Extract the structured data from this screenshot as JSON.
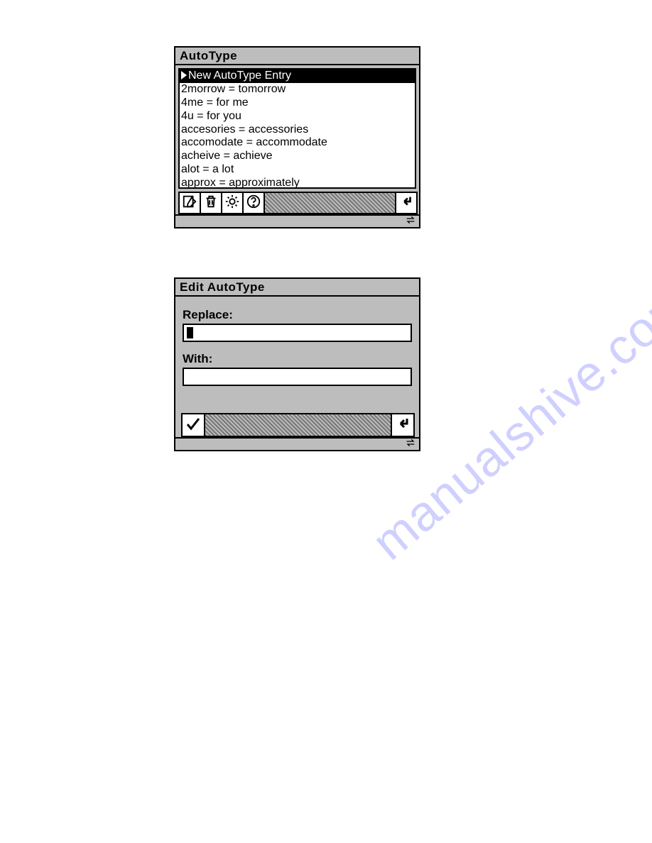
{
  "watermark_text": "manualshive.com",
  "autotype_window": {
    "title": "AutoType",
    "selected_row": "New AutoType Entry",
    "entries": [
      "2morrow = tomorrow",
      "4me = for me",
      "4u = for you",
      "accesories = accessories",
      "accomodate = accommodate",
      "acheive = achieve",
      "alot = a lot",
      "approx = approximately"
    ]
  },
  "edit_window": {
    "title": "Edit AutoType",
    "replace_label": "Replace:",
    "replace_value": "",
    "with_label": "With:",
    "with_value": ""
  }
}
